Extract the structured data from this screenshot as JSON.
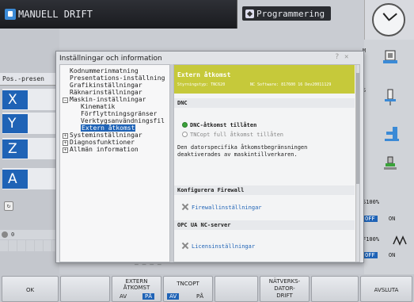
{
  "header": {
    "mode": "MANUELL DRIFT",
    "program": "Programmering"
  },
  "left": {
    "pos_label": "Pos.-presen",
    "axes": [
      "X",
      "Y",
      "Z",
      "A"
    ],
    "bottom_value": "0"
  },
  "dialog": {
    "title": "Inställningar och information",
    "tree": [
      {
        "label": "Kodnummerinmatning",
        "indent": 0,
        "expand": "",
        "selected": false
      },
      {
        "label": "Presentations-inställning",
        "indent": 0,
        "expand": "",
        "selected": false
      },
      {
        "label": "Grafikinställningar",
        "indent": 0,
        "expand": "",
        "selected": false
      },
      {
        "label": "Räknarinställningar",
        "indent": 0,
        "expand": "",
        "selected": false
      },
      {
        "label": "Maskin-inställningar",
        "indent": 0,
        "expand": "−",
        "selected": false
      },
      {
        "label": "Kinematik",
        "indent": 1,
        "expand": "",
        "selected": false
      },
      {
        "label": "Förflyttningsgränser",
        "indent": 1,
        "expand": "",
        "selected": false
      },
      {
        "label": "Verktygsanvändningsfil",
        "indent": 1,
        "expand": "",
        "selected": false
      },
      {
        "label": "Extern åtkomst",
        "indent": 1,
        "expand": "",
        "selected": true
      },
      {
        "label": "Systeminställningar",
        "indent": 0,
        "expand": "+",
        "selected": false
      },
      {
        "label": "Diagnosfunktioner",
        "indent": 0,
        "expand": "+",
        "selected": false
      },
      {
        "label": "Allmän information",
        "indent": 0,
        "expand": "+",
        "selected": false
      }
    ],
    "content": {
      "title": "Extern åtkomst",
      "control_type": "Styrningstyp: TNC620",
      "nc_software": "NC Software: 817600 16 Dev20011129",
      "dnc_section": "DNC",
      "dnc_allowed": "DNC-åtkomst tillåten",
      "tncopt_full": "TNCopt full åtkomst tillåten",
      "info_line1": "Den datorspecifika åtkomstbegränsningen",
      "info_line2": "deaktiverades av maskintillverkaren.",
      "firewall_section": "Konfigurera Firewall",
      "firewall_link": "Firewallinställningar",
      "opcua_section": "OPC UA NC-server",
      "license_link": "Licensinställningar"
    }
  },
  "right": {
    "tab_m": "M",
    "tab_s": "S",
    "s_percent": "S100%",
    "f_percent": "F100%",
    "off": "OFF",
    "on": "ON"
  },
  "softkeys": {
    "ok": "OK",
    "extern_line1": "EXTERN",
    "extern_line2": "ÅTKOMST",
    "av": "AV",
    "pa": "PÅ",
    "tncopt": "TNCOPT",
    "natverk_line1": "NÄTVERKS-",
    "natverk_line2": "DATOR-",
    "natverk_line3": "DRIFT",
    "avsluta": "AVSLUTA"
  },
  "colors": {
    "axis_blue": "#1f63b6",
    "header_green": "#c6c93a",
    "link_blue": "#1f63b6",
    "radio_green": "#3aa23a"
  }
}
